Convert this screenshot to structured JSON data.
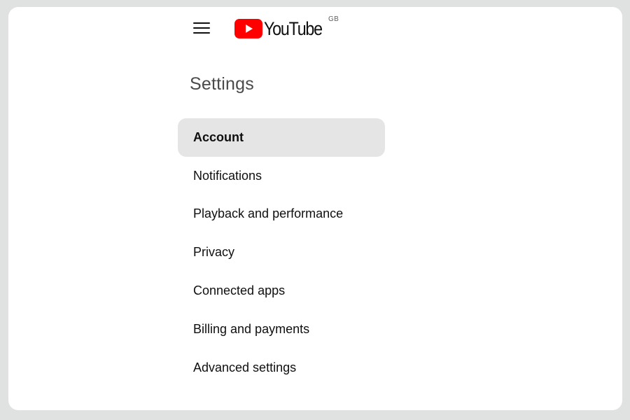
{
  "header": {
    "logo_text": "YouTube",
    "region_code": "GB",
    "menu_icon": "hamburger-menu-icon",
    "logo_icon": "youtube-play-icon",
    "brand_color": "#ff0000"
  },
  "page": {
    "title": "Settings"
  },
  "sidebar": {
    "selected_index": 0,
    "selected_background": "#e5e5e5",
    "items": [
      {
        "label": "Account"
      },
      {
        "label": "Notifications"
      },
      {
        "label": "Playback and performance"
      },
      {
        "label": "Privacy"
      },
      {
        "label": "Connected apps"
      },
      {
        "label": "Billing and payments"
      },
      {
        "label": "Advanced settings"
      }
    ]
  }
}
